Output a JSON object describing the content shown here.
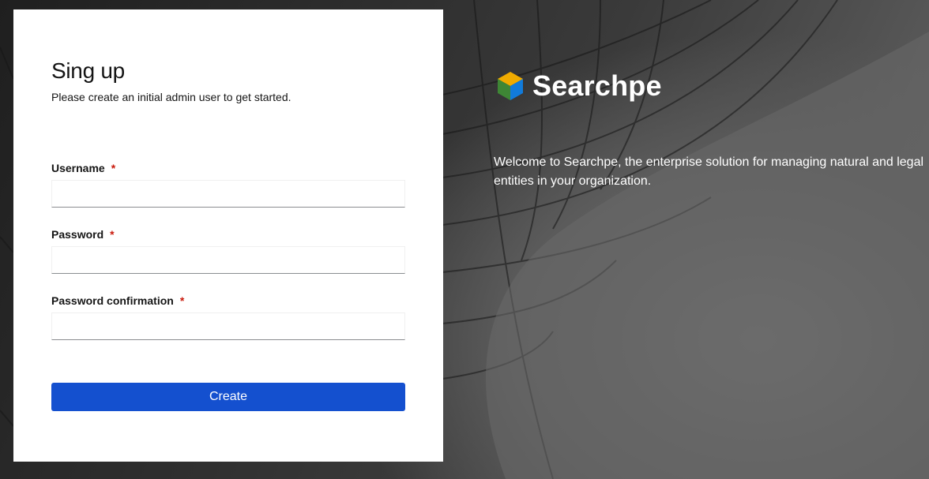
{
  "form": {
    "title": "Sing up",
    "subtitle": "Please create an initial admin user to get started.",
    "fields": [
      {
        "label": "Username",
        "required_mark": "*",
        "value": ""
      },
      {
        "label": "Password",
        "required_mark": "*",
        "value": ""
      },
      {
        "label": "Password confirmation",
        "required_mark": "*",
        "value": ""
      }
    ],
    "submit_label": "Create"
  },
  "brand": {
    "name": "Searchpe",
    "logo_icon": "cube-logo-icon",
    "welcome_text": "Welcome to Searchpe, the enterprise solution for managing natural and legal entities in your organization."
  },
  "colors": {
    "primary_button": "#1450cf",
    "required": "#c9190b",
    "card_background": "#ffffff"
  }
}
